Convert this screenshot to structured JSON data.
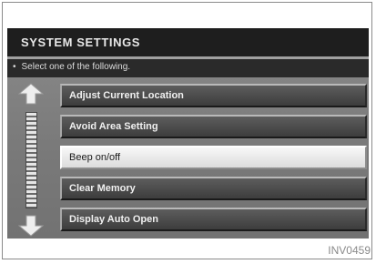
{
  "header": {
    "title": "SYSTEM SETTINGS"
  },
  "prompt": {
    "bullet": "•",
    "text": "Select one of the following."
  },
  "menu": {
    "items": [
      {
        "label": "Adjust Current Location",
        "selected": false
      },
      {
        "label": "Avoid Area Setting",
        "selected": false
      },
      {
        "label": "Beep on/off",
        "selected": true
      },
      {
        "label": "Clear Memory",
        "selected": false
      },
      {
        "label": "Display Auto Open",
        "selected": false
      }
    ]
  },
  "scroll": {
    "up_icon": "up-arrow-icon",
    "down_icon": "down-arrow-icon"
  },
  "figure_code": "INV0459",
  "colors": {
    "header": "#1e1e1e",
    "screen": "#7a7a7a",
    "selected": "#f0f0f0"
  }
}
